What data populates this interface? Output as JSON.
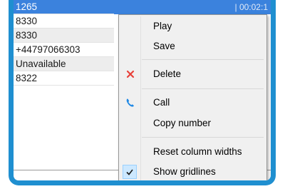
{
  "list": {
    "rows": [
      "1265",
      "8330",
      "8330",
      "+44797066303",
      "Unavailable",
      "8322"
    ],
    "header_fragment": "| 00:02:1"
  },
  "menu": {
    "items": {
      "play": "Play",
      "save": "Save",
      "delete": "Delete",
      "call": "Call",
      "copy_number": "Copy number",
      "reset_column_widths": "Reset column widths",
      "show_gridlines": "Show gridlines"
    },
    "show_gridlines_checked": true,
    "colors": {
      "delete_icon": "#e8413a",
      "call_icon": "#1e88e5",
      "selection": "#3b82dd"
    }
  }
}
